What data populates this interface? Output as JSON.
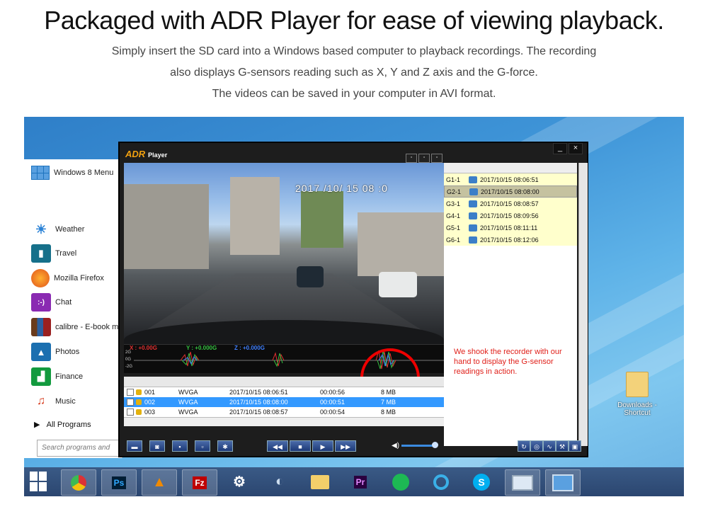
{
  "header": {
    "title": "Packaged with ADR Player for ease of viewing playback.",
    "line1": "Simply insert the SD card into a Windows based computer to playback recordings.  The recording",
    "line2": "also displays G-sensors reading such as X, Y and Z axis and the G-force.",
    "line3": "The videos can be saved in your computer in AVI format."
  },
  "start_menu": {
    "title": "Windows 8 Menu",
    "items": [
      "Weather",
      "Travel",
      "Mozilla Firefox",
      "Chat",
      "calibre - E-book m",
      "Photos",
      "Finance",
      "Music"
    ],
    "all_programs": "All Programs",
    "search_placeholder": "Search programs and"
  },
  "player": {
    "brand": "ADR",
    "brand_sub": "Player",
    "minimize": "_",
    "close": "×",
    "video_timestamp": "2017 /10/ 15  08 :0",
    "graph": {
      "x_label": "X : +0.00G",
      "y_label": "Y : +0.000G",
      "z_label": "Z : +0.000G",
      "ticks": [
        "2G",
        "0G",
        "-2G"
      ]
    },
    "gsensor_list": [
      {
        "id": "G1-1",
        "time": "2017/10/15  08:06:51"
      },
      {
        "id": "G2-1",
        "time": "2017/10/15  08:08:00"
      },
      {
        "id": "G3-1",
        "time": "2017/10/15  08:08:57"
      },
      {
        "id": "G4-1",
        "time": "2017/10/15  08:09:56"
      },
      {
        "id": "G5-1",
        "time": "2017/10/15  08:11:11"
      },
      {
        "id": "G6-1",
        "time": "2017/10/15  08:12:06"
      }
    ],
    "files": [
      {
        "no": "001",
        "res": "WVGA",
        "date": "2017/10/15 08:06:51",
        "dur": "00:00:56",
        "size": "8 MB"
      },
      {
        "no": "002",
        "res": "WVGA",
        "date": "2017/10/15 08:08:00",
        "dur": "00:00:51",
        "size": "7 MB"
      },
      {
        "no": "003",
        "res": "WVGA",
        "date": "2017/10/15 08:08:57",
        "dur": "00:00:54",
        "size": "8 MB"
      }
    ],
    "note": "We shook the recorder with our hand to display the G-sensor readings in action.",
    "volume_fraction": 0.9
  },
  "desktop": {
    "shortcut_label_1": "Downloads -",
    "shortcut_label_2": "Shortcut"
  },
  "taskbar": {
    "apps": [
      "chrome-icon",
      "photoshop-icon",
      "vlc-icon",
      "filezilla-icon",
      "steam-icon",
      "media-icon",
      "explorer-icon",
      "premiere-icon",
      "spotify-icon",
      "circle-app-icon",
      "skype-icon",
      "monitor-icon",
      "control-panel-icon"
    ],
    "ps_label": "Ps",
    "pr_label": "Pr",
    "fz_label": "Fz",
    "skype_label": "S"
  }
}
